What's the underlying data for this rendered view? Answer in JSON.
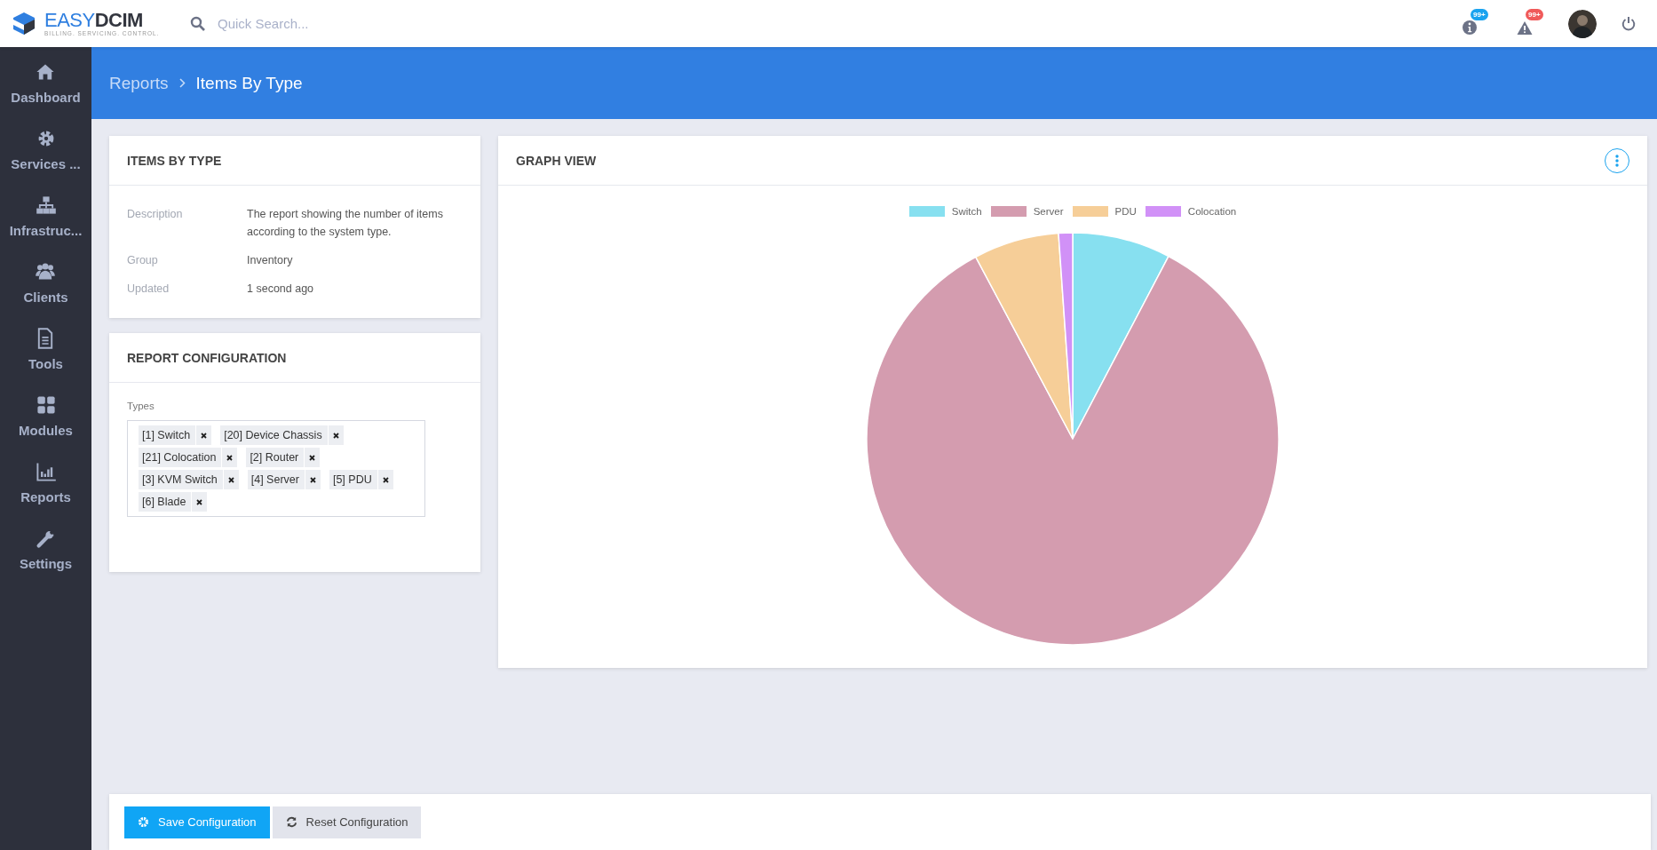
{
  "brand": {
    "name_left": "EASY",
    "name_right": "DCIM",
    "tagline": "BILLING. SERVICING. CONTROL."
  },
  "search": {
    "placeholder": "Quick Search..."
  },
  "notifications": [
    {
      "badge": "99+",
      "color": "#1aa3ef"
    },
    {
      "badge": "99+",
      "color": "#f05a5a"
    }
  ],
  "sidebar": {
    "items": [
      {
        "label": "Dashboard"
      },
      {
        "label": "Services ..."
      },
      {
        "label": "Infrastruc..."
      },
      {
        "label": "Clients"
      },
      {
        "label": "Tools"
      },
      {
        "label": "Modules"
      },
      {
        "label": "Reports"
      },
      {
        "label": "Settings"
      }
    ]
  },
  "breadcrumb": [
    "Reports",
    "Items By Type"
  ],
  "info_card": {
    "title": "ITEMS BY TYPE",
    "rows": [
      {
        "label": "Description",
        "value": "The report showing the number of items according to the system type."
      },
      {
        "label": "Group",
        "value": "Inventory"
      },
      {
        "label": "Updated",
        "value": "1 second ago"
      }
    ]
  },
  "config_card": {
    "title": "REPORT CONFIGURATION",
    "field_label": "Types",
    "tags": [
      "[1] Switch",
      "[20] Device Chassis",
      "[21] Colocation",
      "[2] Router",
      "[3] KVM Switch",
      "[4] Server",
      "[5] PDU",
      "[6] Blade"
    ]
  },
  "graph_card": {
    "title": "GRAPH VIEW",
    "legend": [
      {
        "label": "Switch",
        "color": "#87e0f0"
      },
      {
        "label": "Server",
        "color": "#d49caf"
      },
      {
        "label": "PDU",
        "color": "#f6ce98"
      },
      {
        "label": "Colocation",
        "color": "#d191f7"
      }
    ]
  },
  "buttons": [
    {
      "label": "Save Configuration",
      "kind": "primary"
    },
    {
      "label": "Reset Configuration",
      "kind": "secondary"
    }
  ]
}
